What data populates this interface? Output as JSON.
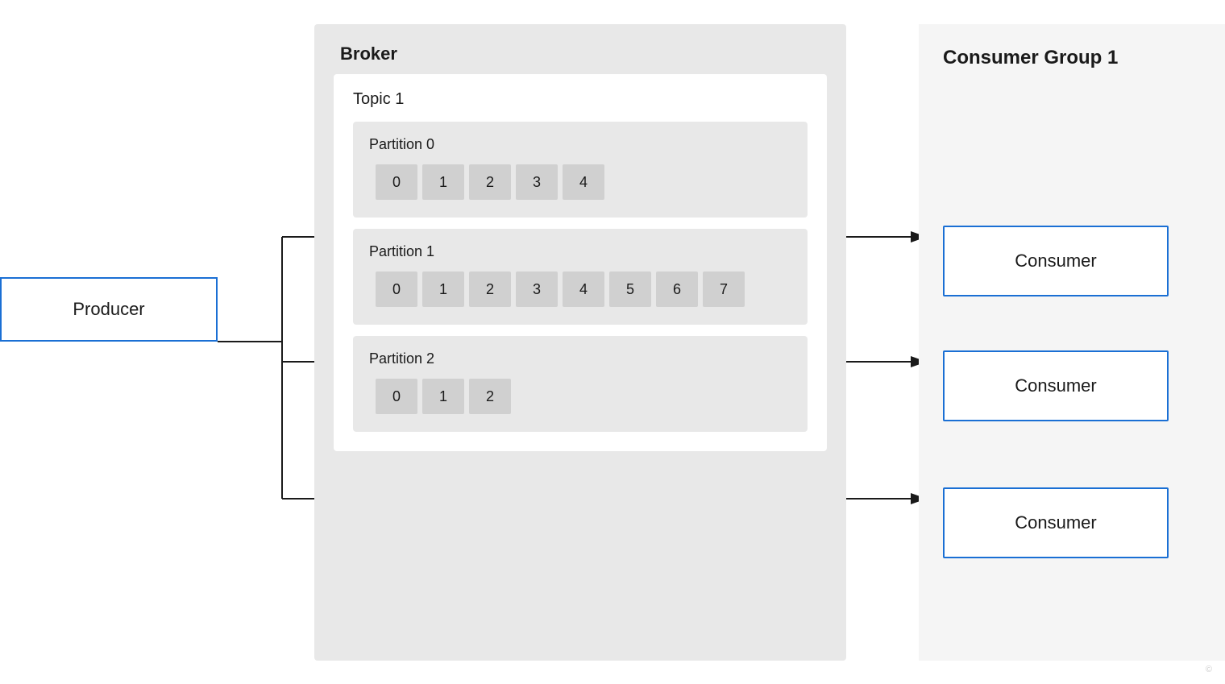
{
  "producer": {
    "label": "Producer"
  },
  "broker": {
    "title": "Broker",
    "topic": {
      "name": "Topic 1",
      "partitions": [
        {
          "name": "Partition 0",
          "cells": [
            0,
            1,
            2,
            3,
            4
          ]
        },
        {
          "name": "Partition 1",
          "cells": [
            0,
            1,
            2,
            3,
            4,
            5,
            6,
            7
          ]
        },
        {
          "name": "Partition 2",
          "cells": [
            0,
            1,
            2
          ]
        }
      ]
    }
  },
  "consumer_group": {
    "title": "Consumer Group 1",
    "consumers": [
      {
        "label": "Consumer"
      },
      {
        "label": "Consumer"
      },
      {
        "label": "Consumer"
      }
    ]
  },
  "colors": {
    "blue_border": "#1a6fd4",
    "cell_bg": "#d0d0d0",
    "broker_bg": "#e8e8e8",
    "partition_bg": "#e8e8e8",
    "topic_bg": "#ffffff"
  }
}
